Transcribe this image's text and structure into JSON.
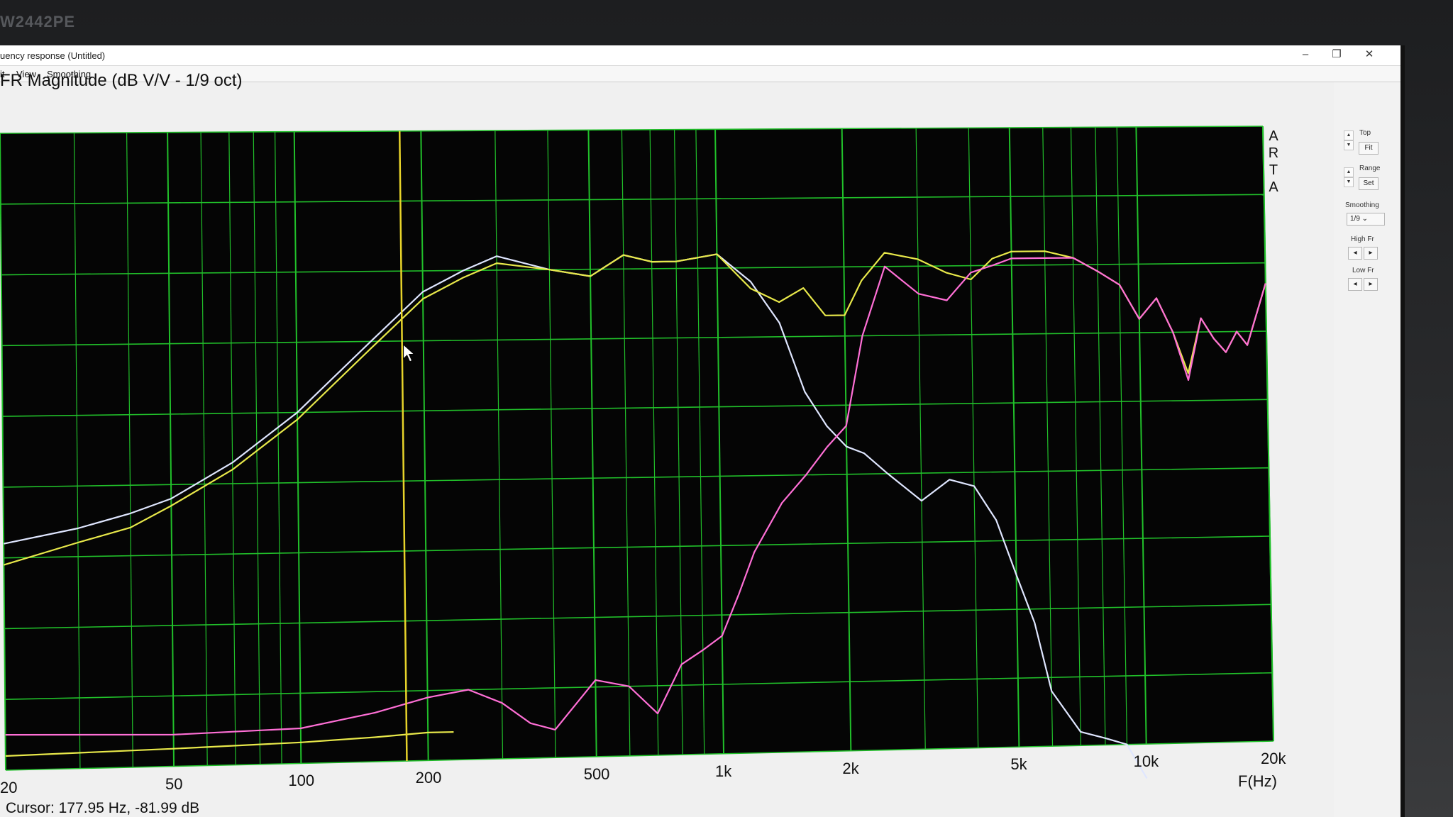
{
  "monitor": {
    "model": "W2442PE"
  },
  "window": {
    "title": "uency response (Untitled)",
    "controls": {
      "minimize": "–",
      "maximize": "❐",
      "close": "✕"
    }
  },
  "menu": {
    "items": [
      "it",
      "View",
      "Smoothing"
    ]
  },
  "graph": {
    "title": "FR Magnitude (dB V/V - 1/9 oct)",
    "watermark": [
      "A",
      "R",
      "T",
      "A"
    ],
    "cursor_readout": "Cursor: 177.95 Hz, -81.99 dB",
    "colors": {
      "background": "#050505",
      "grid": "#21c02a",
      "cursor": "#e7d32a",
      "series_white": "#dfe6ff",
      "series_yellow": "#e8e84a",
      "series_magenta": "#ff6fd6"
    }
  },
  "chart_data": {
    "type": "line",
    "title": "FR Magnitude (dB V/V - 1/9 oct)",
    "xlabel": "F(Hz)",
    "ylabel": "",
    "x_scale": "log",
    "xlim": [
      20,
      20000
    ],
    "ylim": [
      -120,
      -30
    ],
    "grid": true,
    "x_tick_labels": [
      "20",
      "50",
      "100",
      "200",
      "500",
      "1k",
      "2k",
      "5k",
      "10k",
      "20k"
    ],
    "x_ticks": [
      20,
      50,
      100,
      200,
      500,
      1000,
      2000,
      5000,
      10000,
      20000
    ],
    "cursor": {
      "freq": 177.95,
      "db": -81.99
    },
    "series": [
      {
        "color": "#dfe6ff",
        "x": [
          20,
          30,
          40,
          50,
          70,
          100,
          150,
          200,
          250,
          300,
          400,
          500,
          600,
          700,
          800,
          1000,
          1200,
          1400,
          1600,
          1800,
          2000,
          2200,
          2500,
          3000,
          3500,
          4000,
          4500,
          5000,
          5500,
          6000,
          7000,
          8000,
          9000,
          10000
        ],
        "y": [
          -88,
          -86,
          -84,
          -82,
          -77,
          -70,
          -60,
          -53,
          -50,
          -48,
          -50,
          -51,
          -48,
          -49,
          -49,
          -48,
          -52,
          -58,
          -68,
          -73,
          -76,
          -77,
          -80,
          -84,
          -81,
          -82,
          -87,
          -95,
          -102,
          -112,
          -118,
          -119,
          -120,
          -130
        ]
      },
      {
        "color": "#e8e84a",
        "x": [
          20,
          30,
          40,
          50,
          70,
          100,
          150,
          200,
          250,
          300,
          400,
          500,
          600,
          700,
          800,
          1000,
          1200,
          1400,
          1600,
          1800,
          2000,
          2200,
          2500,
          3000,
          3500,
          4000,
          4500,
          5000,
          6000,
          7000,
          8000,
          9000,
          10000,
          11000,
          12000,
          13000,
          14000,
          15000,
          16000,
          17000,
          18000,
          20000
        ],
        "y": [
          -91,
          -88,
          -86,
          -83,
          -78,
          -71,
          -61,
          -54,
          -51,
          -49,
          -50,
          -51,
          -48,
          -49,
          -49,
          -48,
          -53,
          -55,
          -53,
          -57,
          -57,
          -52,
          -48,
          -49,
          -51,
          -52,
          -49,
          -48,
          -48,
          -49,
          -51,
          -53,
          -58,
          -55,
          -60,
          -66,
          -58,
          -61,
          -63,
          -60,
          -62,
          -53
        ]
      },
      {
        "color": "#ff6fd6",
        "x": [
          20,
          50,
          100,
          150,
          200,
          250,
          300,
          350,
          400,
          500,
          600,
          700,
          800,
          900,
          1000,
          1100,
          1200,
          1400,
          1600,
          1800,
          2000,
          2200,
          2500,
          3000,
          3500,
          4000,
          4500,
          5000,
          6000,
          7000,
          8000,
          9000,
          10000,
          11000,
          12000,
          13000,
          14000,
          15000,
          16000,
          17000,
          18000,
          20000
        ],
        "y": [
          -115,
          -115.5,
          -115,
          -113,
          -111,
          -110,
          -112,
          -115,
          -116,
          -109,
          -110,
          -114,
          -107,
          -105,
          -103,
          -97,
          -91,
          -84,
          -80,
          -76,
          -73,
          -60,
          -50,
          -54,
          -55,
          -51,
          -50,
          -49,
          -49,
          -49,
          -51,
          -53,
          -58,
          -55,
          -60,
          -67,
          -58,
          -61,
          -63,
          -60,
          -62,
          -53
        ]
      },
      {
        "color": "#e8e84a",
        "x": [
          20,
          50,
          100,
          150,
          200,
          230
        ],
        "y": [
          -118,
          -117.5,
          -117,
          -116.5,
          -116,
          -116
        ]
      }
    ]
  }
}
